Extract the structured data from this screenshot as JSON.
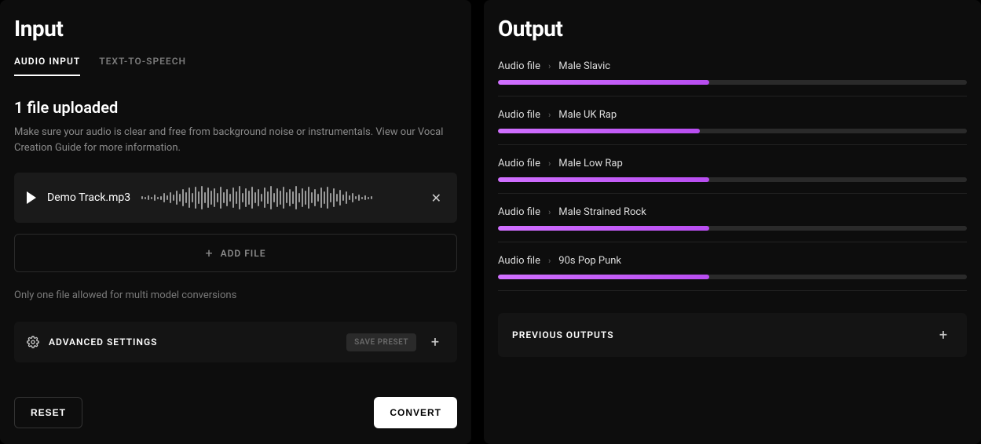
{
  "input": {
    "title": "Input",
    "tabs": {
      "audio": "AUDIO INPUT",
      "tts": "TEXT-TO-SPEECH"
    },
    "uploadHeading": "1 file uploaded",
    "uploadDesc": "Make sure your audio is clear and free from background noise or instrumentals. View our Vocal Creation Guide for more information.",
    "fileName": "Demo Track.mp3",
    "addFile": "ADD FILE",
    "limitNote": "Only one file allowed for multi model conversions",
    "advanced": "ADVANCED SETTINGS",
    "savePreset": "SAVE PRESET",
    "reset": "RESET",
    "convert": "CONVERT"
  },
  "output": {
    "title": "Output",
    "sourceLabel": "Audio file",
    "items": [
      {
        "voice": "Male Slavic",
        "progress": 45
      },
      {
        "voice": "Male UK Rap",
        "progress": 43
      },
      {
        "voice": "Male Low Rap",
        "progress": 45
      },
      {
        "voice": "Male Strained Rock",
        "progress": 45
      },
      {
        "voice": "90s Pop Punk",
        "progress": 45
      }
    ],
    "previous": "PREVIOUS OUTPUTS"
  }
}
